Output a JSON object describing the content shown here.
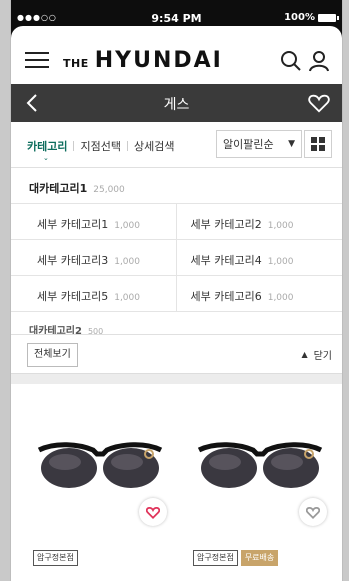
{
  "status_bar": {
    "signal": "●●●○○",
    "time": "9:54 PM",
    "battery": "100%"
  },
  "app_bar": {
    "logo_the": "THE",
    "logo_brand": "HYUNDAI"
  },
  "sub_bar": {
    "title": "게스"
  },
  "filters": {
    "tabs": [
      "카테고리",
      "지점선택",
      "상세검색"
    ],
    "sort_label": "알이팔린순",
    "sort_arrow": "▼"
  },
  "category_panel": {
    "major1": {
      "label": "대카테고리1",
      "count": "25,000"
    },
    "subs": [
      {
        "label": "세부 카테고리1",
        "count": "1,000"
      },
      {
        "label": "세부 카테고리2",
        "count": "1,000"
      },
      {
        "label": "세부 카테고리3",
        "count": "1,000"
      },
      {
        "label": "세부 카테고리4",
        "count": "1,000"
      },
      {
        "label": "세부 카테고리5",
        "count": "1,000"
      },
      {
        "label": "세부 카테고리6",
        "count": "1,000"
      }
    ],
    "major2": {
      "label": "대카테고리2",
      "count": "500"
    },
    "view_all": "전체보기",
    "close_label": "닫기",
    "close_arrow": "▲"
  },
  "products": [
    {
      "tags": [
        "압구정본점"
      ],
      "favorited": true
    },
    {
      "tags": [
        "압구정본점",
        "무료배송"
      ],
      "favorited": false
    }
  ],
  "colors": {
    "accent": "#0e6e5e",
    "heart_active": "#e0335a",
    "free_tag": "#c8a46a",
    "subbar": "#3a3a3a"
  }
}
